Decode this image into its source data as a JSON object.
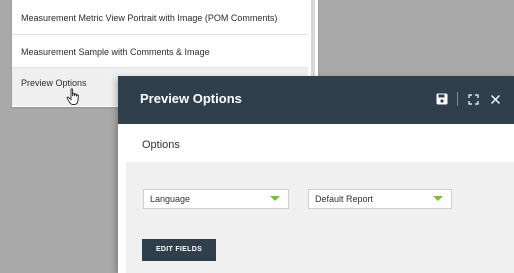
{
  "background_list": {
    "items": [
      {
        "label": "Measurement Metric View Portrait with Image (POM Comments)"
      },
      {
        "label": "Measurement Sample with Comments & Image"
      },
      {
        "label": "Preview Options"
      }
    ]
  },
  "modal": {
    "title": "Preview Options",
    "header_icons": [
      "save-icon",
      "expand-icon",
      "close-icon"
    ],
    "section_label": "Options",
    "selects": [
      {
        "value": "Language"
      },
      {
        "value": "Default Report"
      }
    ],
    "edit_fields_label": "EDIT FIELDS"
  },
  "colors": {
    "header": "#2f3f4b",
    "caret": "#7bbf3a",
    "body_bg": "#f0f0f0"
  }
}
